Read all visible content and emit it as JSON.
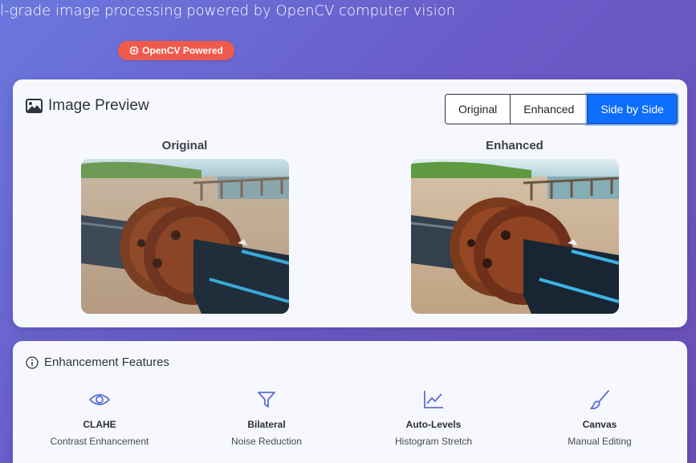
{
  "header": {
    "subtitle": "l-grade image processing powered by OpenCV computer vision",
    "badge": "OpenCV Powered"
  },
  "preview": {
    "title": "Image Preview",
    "view_modes": [
      "Original",
      "Enhanced",
      "Side by Side"
    ],
    "active_view": "Side by Side",
    "original_label": "Original",
    "enhanced_label": "Enhanced"
  },
  "features": {
    "title": "Enhancement Features",
    "items": [
      {
        "name": "CLAHE",
        "desc": "Contrast Enhancement",
        "icon": "eye-icon"
      },
      {
        "name": "Bilateral",
        "desc": "Noise Reduction",
        "icon": "filter-icon"
      },
      {
        "name": "Auto-Levels",
        "desc": "Histogram Stretch",
        "icon": "chart-line-icon"
      },
      {
        "name": "Canvas",
        "desc": "Manual Editing",
        "icon": "brush-icon"
      }
    ]
  },
  "colors": {
    "accent": "#0d6efd",
    "badge": "#f05a4a",
    "icon": "#5b6fd6"
  }
}
